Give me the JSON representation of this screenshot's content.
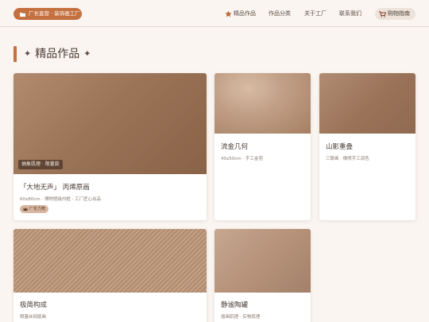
{
  "header": {
    "brand": "厂长直营 · 装饰画工厂",
    "nav": [
      "精品作品",
      "作品分类",
      "关于工厂",
      "联系我们"
    ],
    "cart": "购物指南"
  },
  "section": {
    "title": "精品作品",
    "sparkle": "✦"
  },
  "cards": [
    {
      "name": "「大地无声」 丙烯原画",
      "desc": "60x80cm · 博物馆级内框 · 工厂匠心出品",
      "tag": "抽象肌理 · 限量款",
      "badge": "厂长力荐"
    },
    {
      "name": "流金几何",
      "desc": "40x50cm · 手工金箔"
    },
    {
      "name": "山影重叠",
      "desc": "三联画 · 微喷手工润色"
    },
    {
      "name": "极简构成",
      "desc": "限量丝网版画"
    },
    {
      "name": "静谧陶罐",
      "desc": "插画肌理 · 实物肌理"
    }
  ],
  "colors": {
    "accent": "#c4703f",
    "background": "#faf5f1",
    "text": "#4a3b33"
  }
}
